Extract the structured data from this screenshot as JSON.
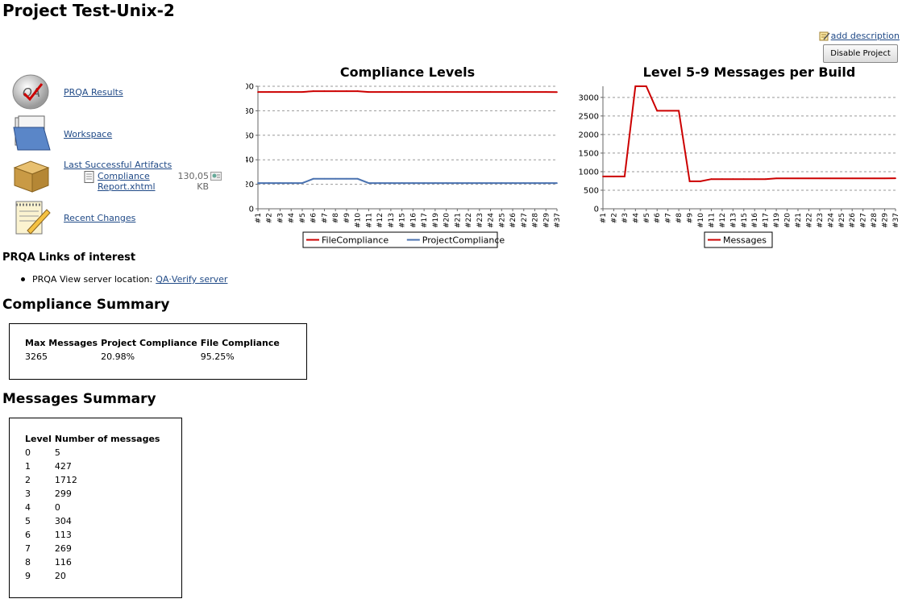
{
  "page": {
    "title": "Project Test-Unix-2",
    "add_description": "add description",
    "disable_button": "Disable Project"
  },
  "sidebar": {
    "items": [
      {
        "label": "PRQA Results",
        "icon": "qa-logo-icon"
      },
      {
        "label": "Workspace",
        "icon": "folder-icon"
      },
      {
        "label": "Last Successful Artifacts",
        "icon": "package-icon"
      },
      {
        "label": "Recent Changes",
        "icon": "notepad-icon"
      }
    ],
    "artifact": {
      "name": "Compliance Report.xhtml",
      "size": "130,05 KB"
    }
  },
  "links": {
    "title": "PRQA Links of interest",
    "items": [
      {
        "prefix": "PRQA View server location: ",
        "link": "QA·Verify server"
      }
    ]
  },
  "compliance_summary": {
    "title": "Compliance Summary",
    "headers": [
      "Max Messages",
      "Project Compliance",
      "File Compliance"
    ],
    "row": [
      "3265",
      "20.98%",
      "95.25%"
    ]
  },
  "messages_summary": {
    "title": "Messages Summary",
    "headers": [
      "Level",
      "Number of messages"
    ],
    "rows": [
      [
        "0",
        "5"
      ],
      [
        "1",
        "427"
      ],
      [
        "2",
        "1712"
      ],
      [
        "3",
        "299"
      ],
      [
        "4",
        "0"
      ],
      [
        "5",
        "304"
      ],
      [
        "6",
        "113"
      ],
      [
        "7",
        "269"
      ],
      [
        "8",
        "116"
      ],
      [
        "9",
        "20"
      ]
    ]
  },
  "chart_data": [
    {
      "type": "line",
      "title": "Compliance Levels",
      "ylim": [
        0,
        100
      ],
      "yticks": [
        0,
        20,
        40,
        60,
        80,
        100
      ],
      "x": [
        "#1",
        "#2",
        "#3",
        "#4",
        "#5",
        "#6",
        "#7",
        "#8",
        "#9",
        "#10",
        "#11",
        "#12",
        "#13",
        "#15",
        "#16",
        "#17",
        "#19",
        "#20",
        "#21",
        "#22",
        "#23",
        "#24",
        "#25",
        "#26",
        "#27",
        "#28",
        "#29",
        "#37"
      ],
      "grid": true,
      "legend": "bottom",
      "series": [
        {
          "name": "FileCompliance",
          "color": "#cc0000",
          "values": [
            95.3,
            95.3,
            95.3,
            95.3,
            95.3,
            96.0,
            96.0,
            96.0,
            96.0,
            96.0,
            95.3,
            95.3,
            95.3,
            95.3,
            95.3,
            95.3,
            95.3,
            95.3,
            95.3,
            95.3,
            95.3,
            95.3,
            95.3,
            95.3,
            95.3,
            95.3,
            95.3,
            95.25
          ]
        },
        {
          "name": "ProjectCompliance",
          "color": "#4a72b0",
          "values": [
            21,
            21,
            21,
            21,
            21,
            24.5,
            24.5,
            24.5,
            24.5,
            24.5,
            21,
            21,
            21,
            21,
            21,
            21,
            21,
            21,
            21,
            21,
            21,
            21,
            21,
            21,
            21,
            21,
            21,
            20.98
          ]
        }
      ]
    },
    {
      "type": "line",
      "title": "Level 5-9 Messages per Build",
      "ylim": [
        0,
        3300
      ],
      "yticks": [
        0,
        500,
        1000,
        1500,
        2000,
        2500,
        3000
      ],
      "x": [
        "#1",
        "#2",
        "#3",
        "#4",
        "#5",
        "#6",
        "#7",
        "#8",
        "#9",
        "#10",
        "#11",
        "#12",
        "#13",
        "#15",
        "#16",
        "#17",
        "#19",
        "#20",
        "#21",
        "#22",
        "#23",
        "#24",
        "#25",
        "#26",
        "#27",
        "#28",
        "#29",
        "#37"
      ],
      "grid": true,
      "legend": "bottom",
      "series": [
        {
          "name": "Messages",
          "color": "#cc0000",
          "values": [
            870,
            870,
            870,
            3300,
            3300,
            2640,
            2640,
            2640,
            740,
            740,
            800,
            800,
            800,
            800,
            800,
            800,
            820,
            820,
            820,
            820,
            820,
            820,
            820,
            820,
            820,
            820,
            820,
            822
          ]
        }
      ]
    }
  ]
}
